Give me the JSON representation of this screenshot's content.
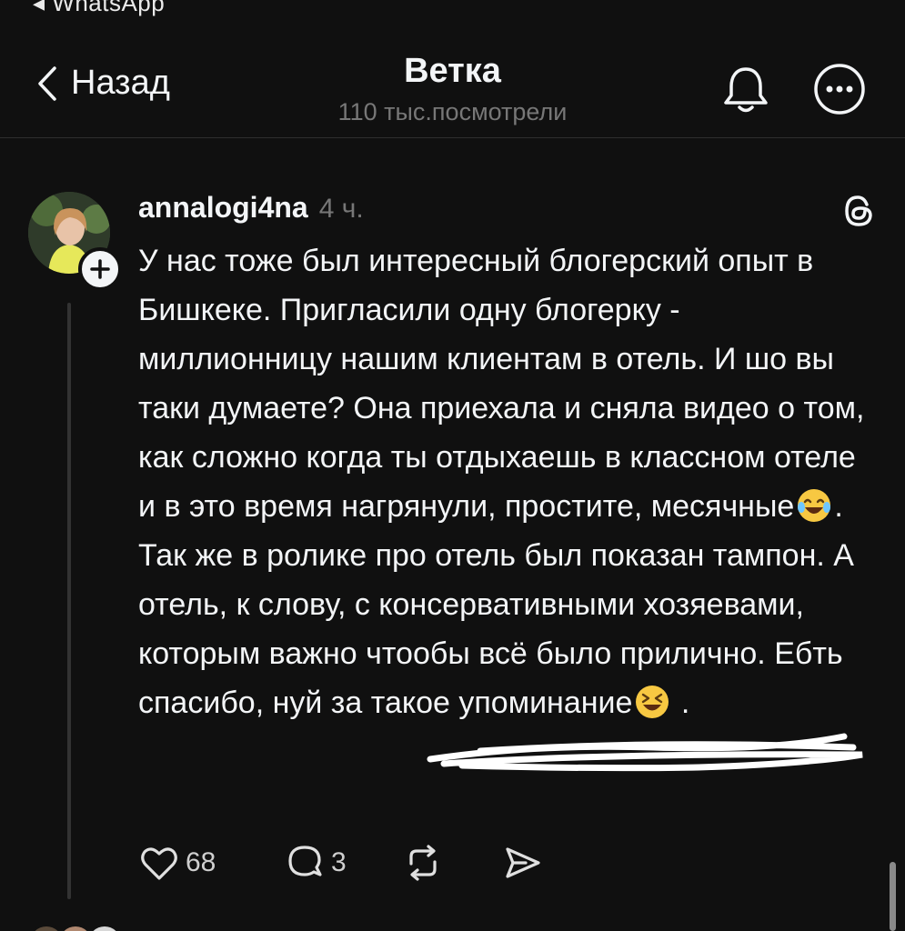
{
  "status_bar": {
    "back_to_app": "◂ WhatsApp"
  },
  "header": {
    "back_label": "Назад",
    "title": "Ветка",
    "subtitle": "110 тыс.посмотрели"
  },
  "post": {
    "username": "annalogi4na",
    "timestamp": "4 ч.",
    "body_part1": "У нас тоже был интересный блогерский опыт в Бишкеке. Пригласили одну блогерку - миллионницу нашим клиентам в отель. И шо вы таки думаете? Она приехала и сняла видео о том, как сложно когда ты отдыхаешь в классном отеле и в это время нагрянули, простите, месячные",
    "emoji_1": "😂",
    "body_part2": ". Так же в ролике про отель был показан тампон. А отель, к слову, с консервативными хозяевами, которым важно чтообы всё было прилично. Ебть спасибо, нуй за такое упоминание",
    "emoji_2": "😆",
    "body_part3": " .",
    "likes": "68",
    "replies": "3"
  },
  "colors": {
    "background": "#101010",
    "text": "#f3f5f7",
    "muted": "#777777",
    "divider": "#2e2e2e"
  },
  "icons": {
    "back": "chevron-left-icon",
    "bell": "bell-icon",
    "more": "more-icon",
    "threads": "threads-logo-icon",
    "like": "heart-icon",
    "reply": "comment-icon",
    "repost": "repost-icon",
    "share": "send-icon"
  }
}
